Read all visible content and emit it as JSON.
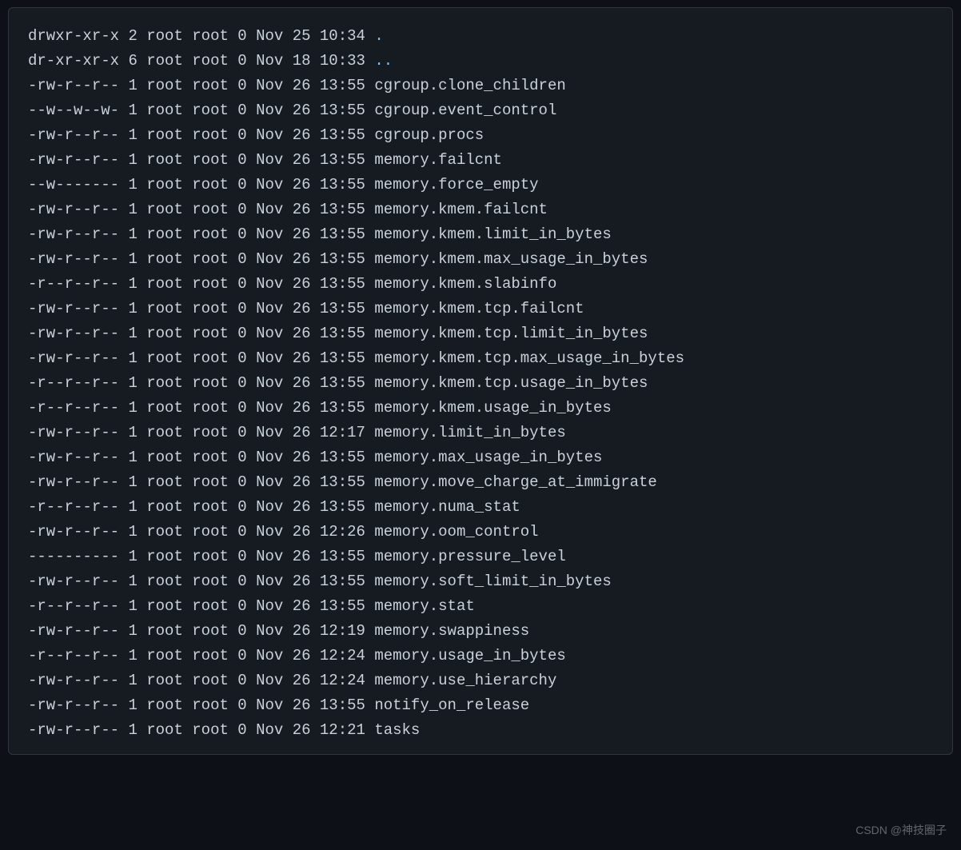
{
  "watermark": "CSDN @神技圈子",
  "sep": " ",
  "rows": [
    {
      "perm": "drwxr-xr-x",
      "links": "2",
      "owner": "root",
      "group": "root",
      "size": "0",
      "date": "Nov 25 10:34",
      "name": ".",
      "dir": true
    },
    {
      "perm": "dr-xr-xr-x",
      "links": "6",
      "owner": "root",
      "group": "root",
      "size": "0",
      "date": "Nov 18 10:33",
      "name": "..",
      "dir": true
    },
    {
      "perm": "-rw-r--r--",
      "links": "1",
      "owner": "root",
      "group": "root",
      "size": "0",
      "date": "Nov 26 13:55",
      "name": "cgroup.clone_children",
      "dir": false
    },
    {
      "perm": "--w--w--w-",
      "links": "1",
      "owner": "root",
      "group": "root",
      "size": "0",
      "date": "Nov 26 13:55",
      "name": "cgroup.event_control",
      "dir": false
    },
    {
      "perm": "-rw-r--r--",
      "links": "1",
      "owner": "root",
      "group": "root",
      "size": "0",
      "date": "Nov 26 13:55",
      "name": "cgroup.procs",
      "dir": false
    },
    {
      "perm": "-rw-r--r--",
      "links": "1",
      "owner": "root",
      "group": "root",
      "size": "0",
      "date": "Nov 26 13:55",
      "name": "memory.failcnt",
      "dir": false
    },
    {
      "perm": "--w-------",
      "links": "1",
      "owner": "root",
      "group": "root",
      "size": "0",
      "date": "Nov 26 13:55",
      "name": "memory.force_empty",
      "dir": false
    },
    {
      "perm": "-rw-r--r--",
      "links": "1",
      "owner": "root",
      "group": "root",
      "size": "0",
      "date": "Nov 26 13:55",
      "name": "memory.kmem.failcnt",
      "dir": false
    },
    {
      "perm": "-rw-r--r--",
      "links": "1",
      "owner": "root",
      "group": "root",
      "size": "0",
      "date": "Nov 26 13:55",
      "name": "memory.kmem.limit_in_bytes",
      "dir": false
    },
    {
      "perm": "-rw-r--r--",
      "links": "1",
      "owner": "root",
      "group": "root",
      "size": "0",
      "date": "Nov 26 13:55",
      "name": "memory.kmem.max_usage_in_bytes",
      "dir": false
    },
    {
      "perm": "-r--r--r--",
      "links": "1",
      "owner": "root",
      "group": "root",
      "size": "0",
      "date": "Nov 26 13:55",
      "name": "memory.kmem.slabinfo",
      "dir": false
    },
    {
      "perm": "-rw-r--r--",
      "links": "1",
      "owner": "root",
      "group": "root",
      "size": "0",
      "date": "Nov 26 13:55",
      "name": "memory.kmem.tcp.failcnt",
      "dir": false
    },
    {
      "perm": "-rw-r--r--",
      "links": "1",
      "owner": "root",
      "group": "root",
      "size": "0",
      "date": "Nov 26 13:55",
      "name": "memory.kmem.tcp.limit_in_bytes",
      "dir": false
    },
    {
      "perm": "-rw-r--r--",
      "links": "1",
      "owner": "root",
      "group": "root",
      "size": "0",
      "date": "Nov 26 13:55",
      "name": "memory.kmem.tcp.max_usage_in_bytes",
      "dir": false
    },
    {
      "perm": "-r--r--r--",
      "links": "1",
      "owner": "root",
      "group": "root",
      "size": "0",
      "date": "Nov 26 13:55",
      "name": "memory.kmem.tcp.usage_in_bytes",
      "dir": false
    },
    {
      "perm": "-r--r--r--",
      "links": "1",
      "owner": "root",
      "group": "root",
      "size": "0",
      "date": "Nov 26 13:55",
      "name": "memory.kmem.usage_in_bytes",
      "dir": false
    },
    {
      "perm": "-rw-r--r--",
      "links": "1",
      "owner": "root",
      "group": "root",
      "size": "0",
      "date": "Nov 26 12:17",
      "name": "memory.limit_in_bytes",
      "dir": false
    },
    {
      "perm": "-rw-r--r--",
      "links": "1",
      "owner": "root",
      "group": "root",
      "size": "0",
      "date": "Nov 26 13:55",
      "name": "memory.max_usage_in_bytes",
      "dir": false
    },
    {
      "perm": "-rw-r--r--",
      "links": "1",
      "owner": "root",
      "group": "root",
      "size": "0",
      "date": "Nov 26 13:55",
      "name": "memory.move_charge_at_immigrate",
      "dir": false
    },
    {
      "perm": "-r--r--r--",
      "links": "1",
      "owner": "root",
      "group": "root",
      "size": "0",
      "date": "Nov 26 13:55",
      "name": "memory.numa_stat",
      "dir": false
    },
    {
      "perm": "-rw-r--r--",
      "links": "1",
      "owner": "root",
      "group": "root",
      "size": "0",
      "date": "Nov 26 12:26",
      "name": "memory.oom_control",
      "dir": false
    },
    {
      "perm": "----------",
      "links": "1",
      "owner": "root",
      "group": "root",
      "size": "0",
      "date": "Nov 26 13:55",
      "name": "memory.pressure_level",
      "dir": false
    },
    {
      "perm": "-rw-r--r--",
      "links": "1",
      "owner": "root",
      "group": "root",
      "size": "0",
      "date": "Nov 26 13:55",
      "name": "memory.soft_limit_in_bytes",
      "dir": false
    },
    {
      "perm": "-r--r--r--",
      "links": "1",
      "owner": "root",
      "group": "root",
      "size": "0",
      "date": "Nov 26 13:55",
      "name": "memory.stat",
      "dir": false
    },
    {
      "perm": "-rw-r--r--",
      "links": "1",
      "owner": "root",
      "group": "root",
      "size": "0",
      "date": "Nov 26 12:19",
      "name": "memory.swappiness",
      "dir": false
    },
    {
      "perm": "-r--r--r--",
      "links": "1",
      "owner": "root",
      "group": "root",
      "size": "0",
      "date": "Nov 26 12:24",
      "name": "memory.usage_in_bytes",
      "dir": false
    },
    {
      "perm": "-rw-r--r--",
      "links": "1",
      "owner": "root",
      "group": "root",
      "size": "0",
      "date": "Nov 26 12:24",
      "name": "memory.use_hierarchy",
      "dir": false
    },
    {
      "perm": "-rw-r--r--",
      "links": "1",
      "owner": "root",
      "group": "root",
      "size": "0",
      "date": "Nov 26 13:55",
      "name": "notify_on_release",
      "dir": false
    },
    {
      "perm": "-rw-r--r--",
      "links": "1",
      "owner": "root",
      "group": "root",
      "size": "0",
      "date": "Nov 26 12:21",
      "name": "tasks",
      "dir": false
    }
  ]
}
